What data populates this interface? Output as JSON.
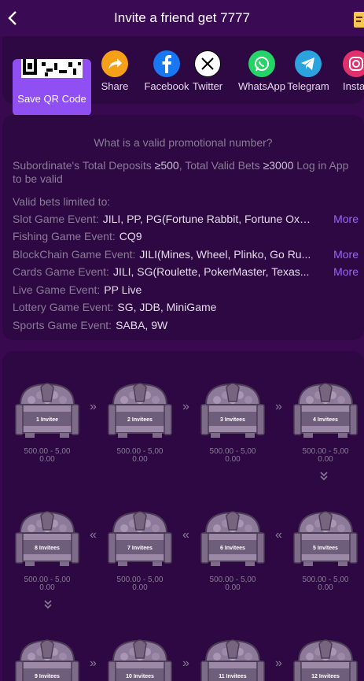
{
  "header": {
    "title": "Invite a friend get 7777",
    "back_icon": "chevron-left-icon",
    "menu_icon": "document-icon"
  },
  "share": {
    "qr_label": "Save QR Code",
    "items": [
      {
        "label": "Share",
        "icon": "share-icon",
        "color": "#f6a01a"
      },
      {
        "label": "Facebook",
        "icon": "facebook-icon",
        "color": "#1877f2"
      },
      {
        "label": "Twitter",
        "icon": "x-icon",
        "color": "#ffffff"
      },
      {
        "label": "WhatsApp",
        "icon": "whatsapp-icon",
        "color": "#25d366"
      },
      {
        "label": "Telegram",
        "icon": "telegram-icon",
        "color": "#2aa3df"
      },
      {
        "label": "Instag",
        "icon": "instagram-icon",
        "color": "#e1306c"
      }
    ]
  },
  "rules": {
    "question": "What is a valid promotional number?",
    "desc_prefix": "Subordinate's Total Deposits",
    "desc_deposit": "≥500",
    "desc_mid": ", Total Valid Bets",
    "desc_bets": "≥3000",
    "desc_suffix": " Log in App to be valid",
    "limited": "Valid bets limited to:",
    "events": [
      {
        "key": "Slot Game Event:",
        "value": "JILI, PP, PG(Fortune Rabbit, Fortune Ox, ...",
        "more": "More"
      },
      {
        "key": "Fishing Game Event:",
        "value": "CQ9",
        "more": ""
      },
      {
        "key": "BlockChain Game Event:",
        "value": "JILI(Mines, Wheel, Plinko, Go Ru...",
        "more": "More"
      },
      {
        "key": "Cards Game Event:",
        "value": "JILI, SG(Roulette, PokerMaster, Texas...",
        "more": "More"
      },
      {
        "key": "Live Game Event:",
        "value": "PP Live",
        "more": ""
      },
      {
        "key": "Lottery Game Event:",
        "value": "SG, JDB, MiniGame",
        "more": ""
      },
      {
        "key": "Sports Game Event:",
        "value": "SABA, 9W",
        "more": ""
      }
    ],
    "more_color": "#9a63ff"
  },
  "chests": {
    "amount_line1": "500.00 - 5,00",
    "amount_line2": "0.00",
    "items": [
      {
        "label": "1 Invitee"
      },
      {
        "label": "2 Invitees"
      },
      {
        "label": "3 Invitees"
      },
      {
        "label": "4 Invitees"
      },
      {
        "label": "5 Invitees"
      },
      {
        "label": "6 Invitees"
      },
      {
        "label": "7 Invitees"
      },
      {
        "label": "8 Invitees"
      },
      {
        "label": "9 Invitees"
      },
      {
        "label": "10 Invitees"
      },
      {
        "label": "11 Invitees"
      },
      {
        "label": "12 Invitees"
      }
    ],
    "arrow_right": "»",
    "arrow_left": "«",
    "arrow_down": "⌄"
  }
}
